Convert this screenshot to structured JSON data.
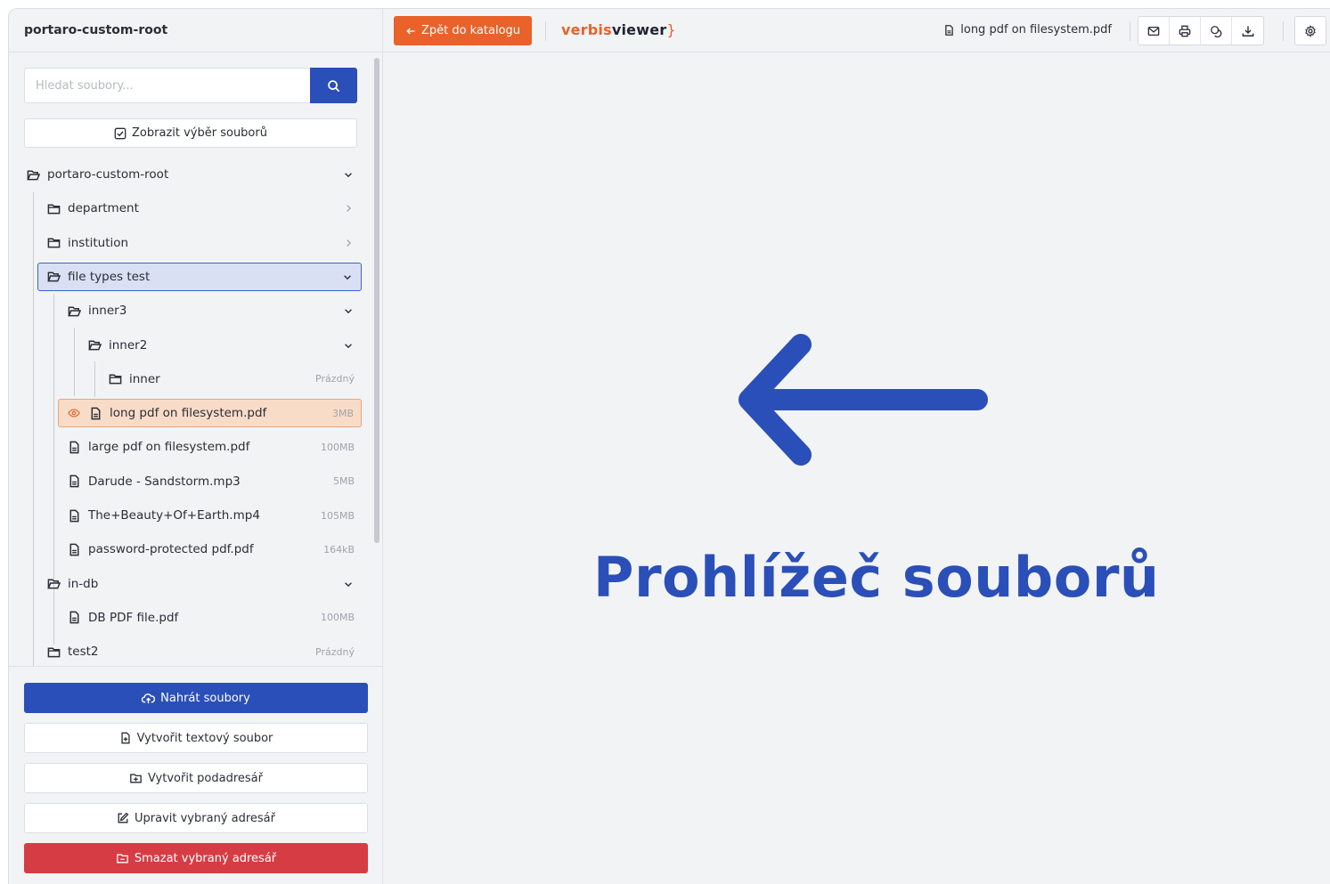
{
  "sidebar": {
    "root_title": "portaro-custom-root",
    "search_placeholder": "Hledat soubory...",
    "show_selection_label": "Zobrazit výběr souborů",
    "tree": [
      {
        "label": "portaro-custom-root",
        "type": "folder-open",
        "meta": "",
        "chevron": "down"
      },
      {
        "label": "department",
        "type": "folder",
        "meta": "",
        "chevron": "right"
      },
      {
        "label": "institution",
        "type": "folder",
        "meta": "",
        "chevron": "right"
      },
      {
        "label": "file types test",
        "type": "folder-open",
        "meta": "",
        "chevron": "down",
        "state": "selected"
      },
      {
        "label": "inner3",
        "type": "folder-open",
        "meta": "",
        "chevron": "down"
      },
      {
        "label": "inner2",
        "type": "folder-open",
        "meta": "",
        "chevron": "down"
      },
      {
        "label": "inner",
        "type": "folder",
        "meta": "Prázdný",
        "chevron": ""
      },
      {
        "label": "long pdf on filesystem.pdf",
        "type": "file",
        "meta": "3MB",
        "chevron": "",
        "state": "active"
      },
      {
        "label": "large pdf on filesystem.pdf",
        "type": "file",
        "meta": "100MB",
        "chevron": ""
      },
      {
        "label": "Darude - Sandstorm.mp3",
        "type": "file",
        "meta": "5MB",
        "chevron": ""
      },
      {
        "label": "The+Beauty+Of+Earth.mp4",
        "type": "file",
        "meta": "105MB",
        "chevron": ""
      },
      {
        "label": "password-protected pdf.pdf",
        "type": "file",
        "meta": "164kB",
        "chevron": ""
      },
      {
        "label": "in-db",
        "type": "folder-open",
        "meta": "",
        "chevron": "down"
      },
      {
        "label": "DB PDF file.pdf",
        "type": "file",
        "meta": "100MB",
        "chevron": ""
      },
      {
        "label": "test2",
        "type": "folder",
        "meta": "Prázdný",
        "chevron": ""
      }
    ],
    "actions": {
      "upload": "Nahrát soubory",
      "create_text": "Vytvořit textový soubor",
      "create_subdir": "Vytvořit podadresář",
      "edit_dir": "Upravit vybraný adresář",
      "delete_dir": "Smazat vybraný adresář"
    }
  },
  "topbar": {
    "back_label": "Zpět do katalogu",
    "brand_part1": "verbis",
    "brand_part2": "viewer",
    "brand_part3": "}",
    "current_file": "long pdf on filesystem.pdf",
    "tools": [
      "mail-icon",
      "print-icon",
      "copy-icon",
      "download-icon"
    ],
    "settings_icon": "gear-icon"
  },
  "main": {
    "placeholder_text": "Prohlížeč souborů"
  },
  "colors": {
    "accent_blue": "#2a4fb8",
    "accent_orange": "#e8622a",
    "danger_red": "#d63c44"
  }
}
